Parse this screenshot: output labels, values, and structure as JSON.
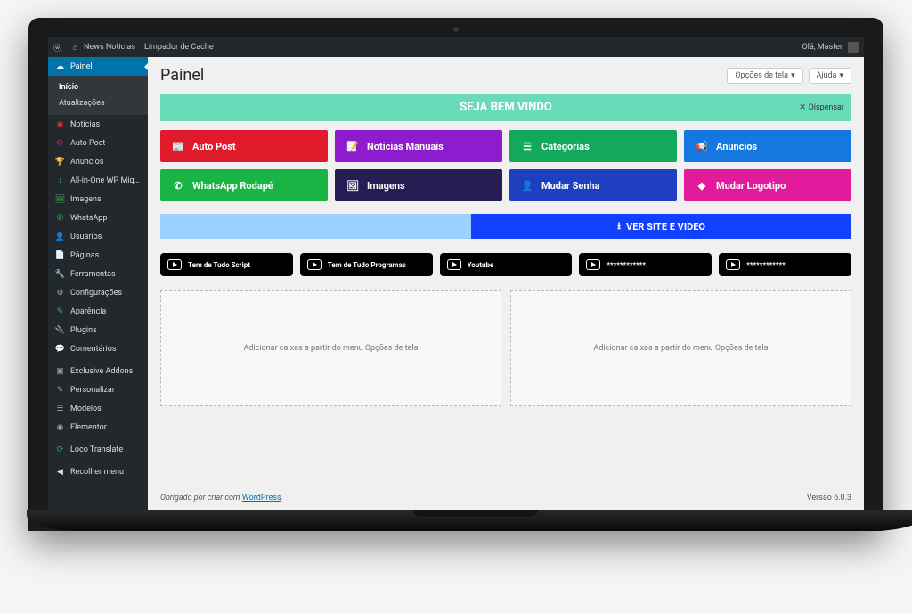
{
  "topbar": {
    "site": "News Noticias",
    "cache": "Limpador de Cache",
    "greeting": "Olá, Master"
  },
  "sidebar": {
    "painel": "Painel",
    "sub": {
      "inicio": "Início",
      "atualizacoes": "Atualizações"
    },
    "items": [
      {
        "label": "Noticias",
        "color": "#d63638",
        "icon": "◉"
      },
      {
        "label": "Auto Post",
        "color": "#d63638",
        "icon": "⟳"
      },
      {
        "label": "Anuncios",
        "color": "#d3a33a",
        "icon": "🏆"
      },
      {
        "label": "All-in-One WP Migration",
        "color": "#46b450",
        "icon": "↕"
      },
      {
        "label": "Imagens",
        "color": "#46b450",
        "icon": "🖼"
      },
      {
        "label": "WhatsApp",
        "color": "#46b450",
        "icon": "✆"
      },
      {
        "label": "Usuários",
        "color": "#9ea3a8",
        "icon": "👤"
      },
      {
        "label": "Páginas",
        "color": "#d3a33a",
        "icon": "📄"
      },
      {
        "label": "Ferramentas",
        "color": "#3498db",
        "icon": "🔧"
      },
      {
        "label": "Configurações",
        "color": "#9ea3a8",
        "icon": "⚙"
      },
      {
        "label": "Aparência",
        "color": "#46b450",
        "icon": "✎"
      },
      {
        "label": "Plugins",
        "color": "#46b450",
        "icon": "🔌"
      },
      {
        "label": "Comentários",
        "color": "#9ea3a8",
        "icon": "💬"
      }
    ],
    "items2": [
      {
        "label": "Exclusive Addons",
        "icon": "▣"
      },
      {
        "label": "Personalizar",
        "icon": "✎"
      },
      {
        "label": "Modelos",
        "icon": "☰"
      },
      {
        "label": "Elementor",
        "icon": "◉"
      }
    ],
    "loco": "Loco Translate",
    "collapse": "Recolher menu"
  },
  "page": {
    "title": "Painel",
    "screen_opts": "Opções de tela",
    "help": "Ajuda"
  },
  "welcome": {
    "title": "SEJA BEM VINDO",
    "dismiss": "Dispensar"
  },
  "tiles": [
    {
      "label": "Auto Post",
      "bg": "#e11a2b",
      "icon": "📰"
    },
    {
      "label": "Noticias Manuais",
      "bg": "#8e1bce",
      "icon": "📝"
    },
    {
      "label": "Categorias",
      "bg": "#12a95c",
      "icon": "☰"
    },
    {
      "label": "Anuncios",
      "bg": "#1478e0",
      "icon": "📢"
    },
    {
      "label": "WhatsApp Rodapé",
      "bg": "#18b545",
      "icon": "✆"
    },
    {
      "label": "Imagens",
      "bg": "#261d52",
      "icon": "🖼"
    },
    {
      "label": "Mudar Senha",
      "bg": "#1e3fbf",
      "icon": "👤"
    },
    {
      "label": "Mudar Logotipo",
      "bg": "#e21b9c",
      "icon": "◆"
    }
  ],
  "site_button": "VER SITE E VIDEO",
  "black_tiles": [
    "Tem de Tudo Script",
    "Tem de Tudo Programas",
    "Youtube",
    "************",
    "************"
  ],
  "dropzone": "Adicionar caixas a partir do menu Opções de tela",
  "footer": {
    "thanks_pre": "Obrigado por criar com ",
    "wp": "WordPress",
    "version": "Versão 6.0.3"
  }
}
